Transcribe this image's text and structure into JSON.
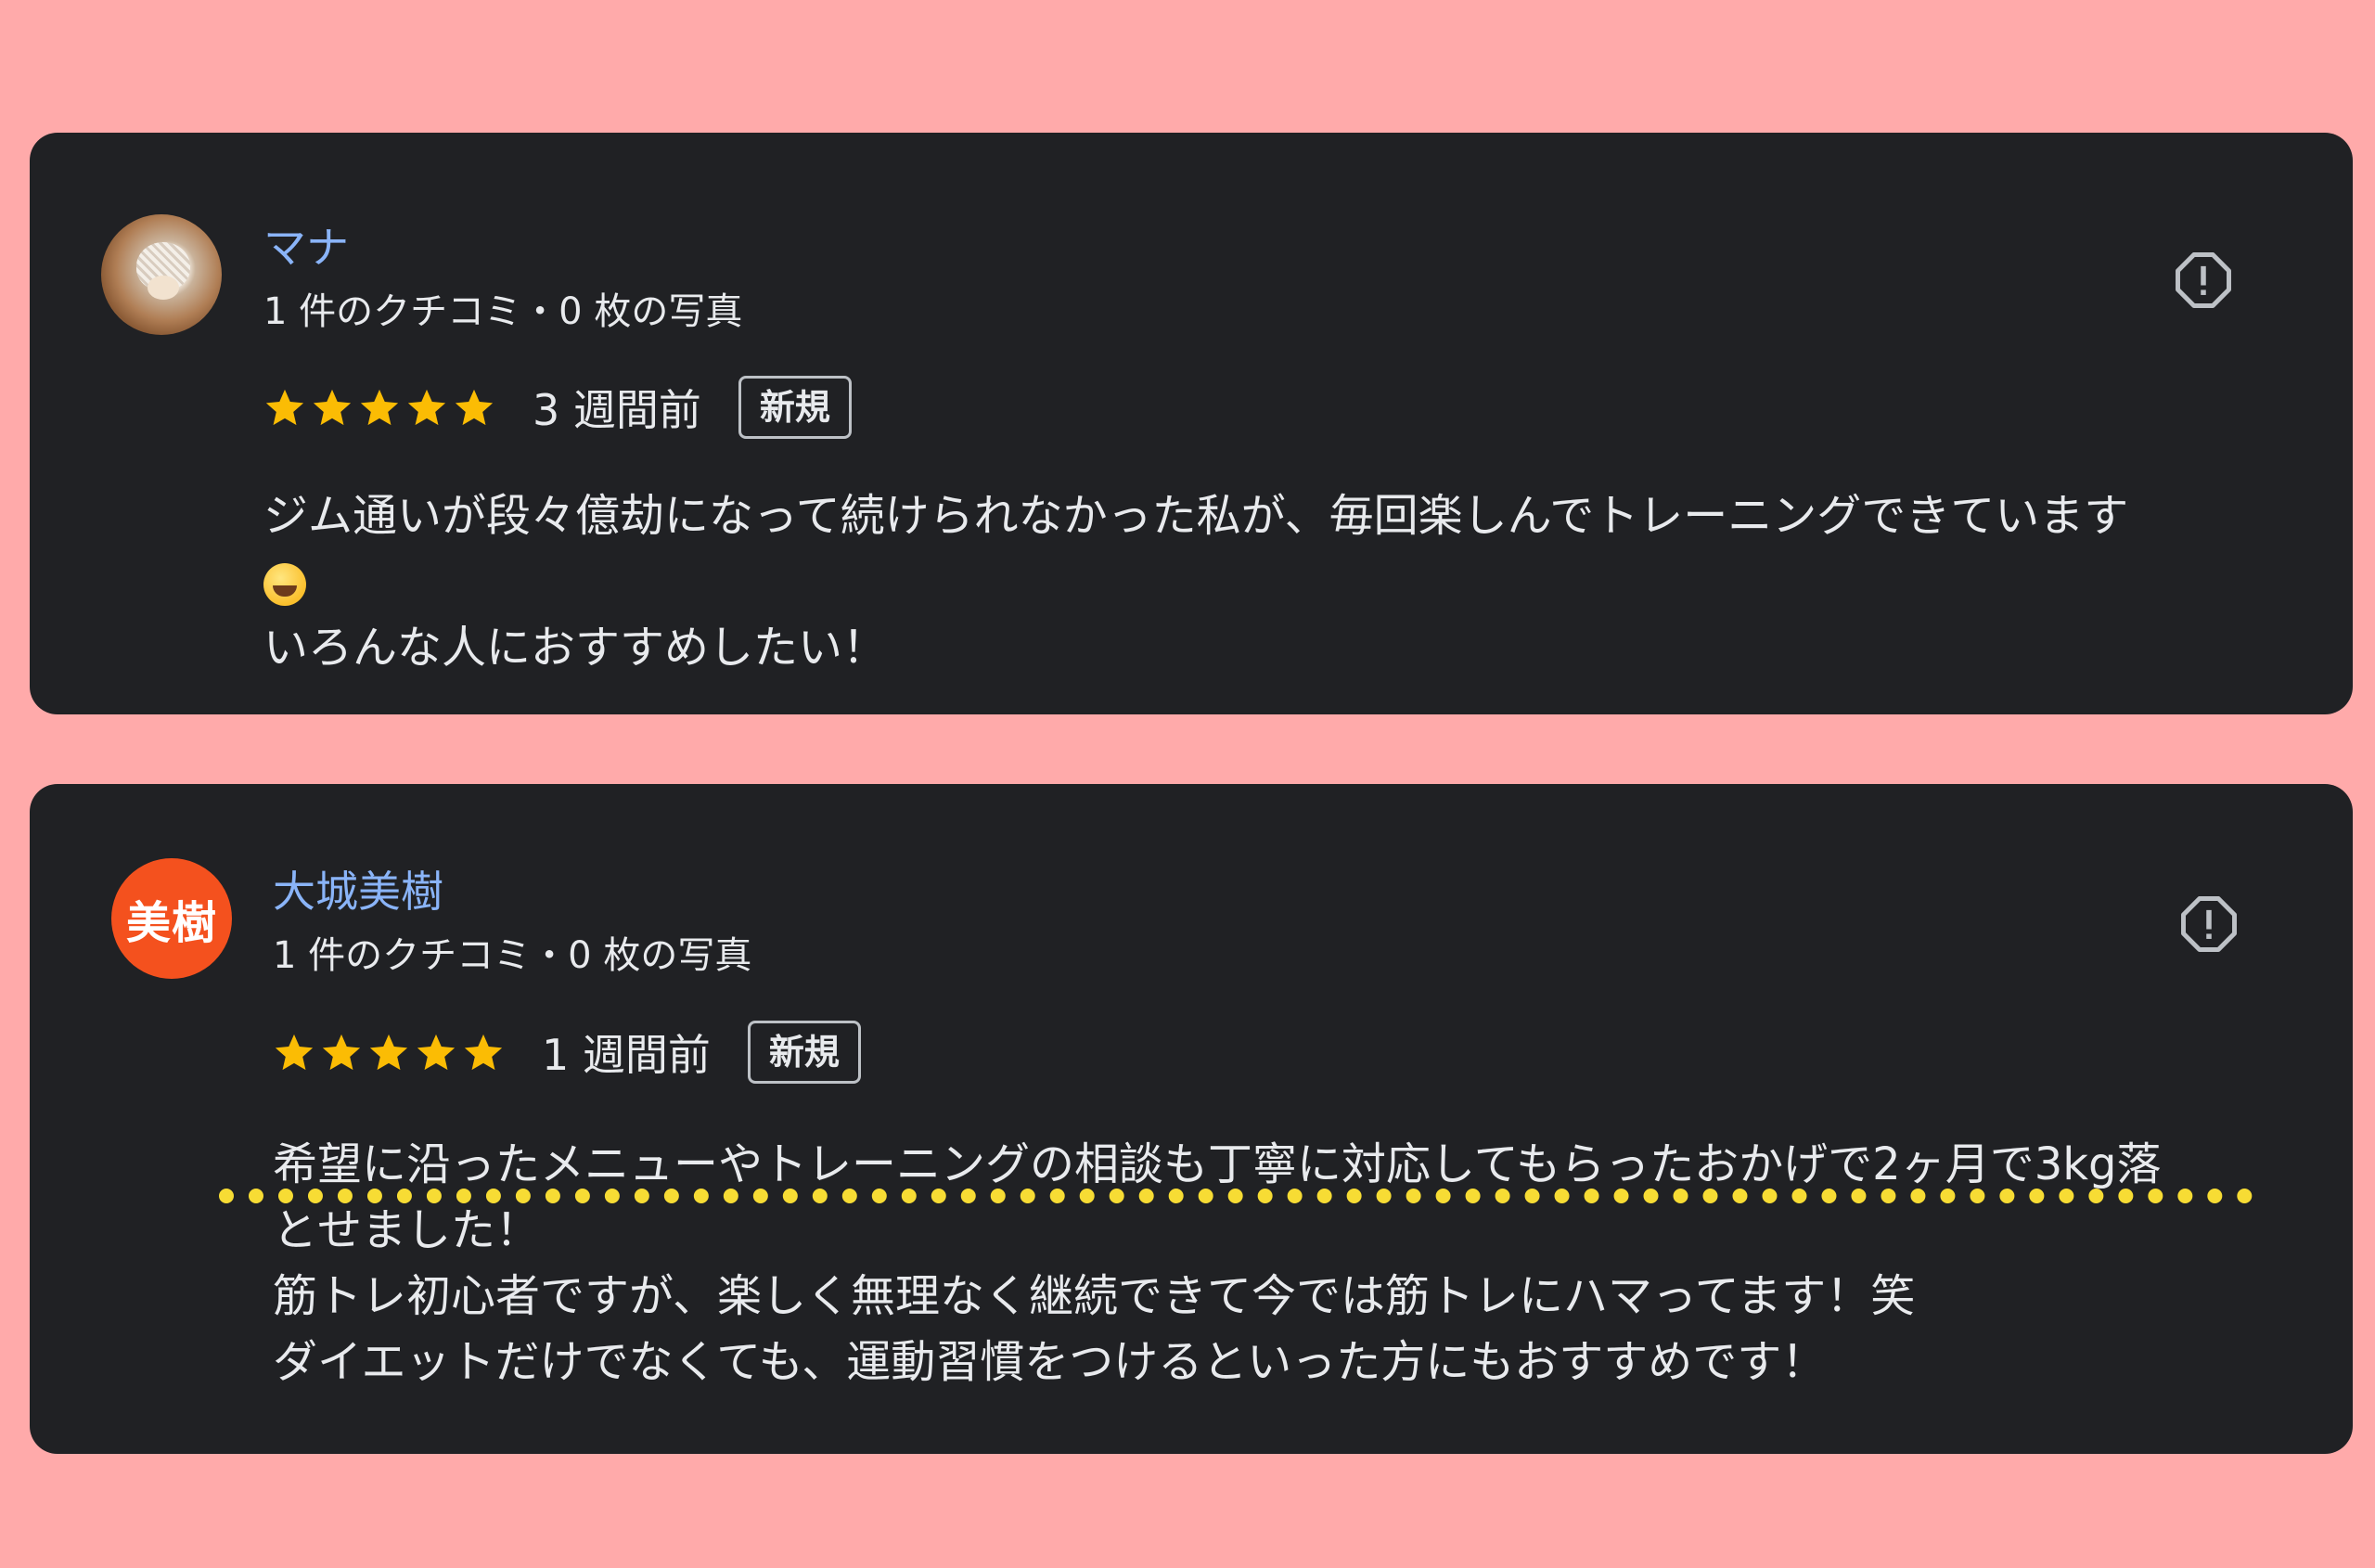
{
  "colors": {
    "background": "#ffaaaa",
    "card": "#202124",
    "name": "#8ab4f8",
    "text": "#e8eaed",
    "star": "#fbbc04",
    "avatar_letter_bg": "#f4511e",
    "dotted_line": "#f7dc34"
  },
  "reviews": [
    {
      "avatar_type": "photo",
      "avatar_icon": "hedgehog-photo",
      "name": "マナ",
      "meta": "1 件のクチコミ・0 枚の写真",
      "rating": 5,
      "time": "3 週間前",
      "badge": "新規",
      "report_icon": "report-icon",
      "text": {
        "line1": "ジム通いが段々億劫になって続けられなかった私が、毎回楽しんでトレーニングできています",
        "emoji": "grinning-squinting-face",
        "line3": "いろんな人におすすめしたい！"
      }
    },
    {
      "avatar_type": "letter",
      "avatar_text": "美樹",
      "name": "大城美樹",
      "meta": "1 件のクチコミ・0 枚の写真",
      "rating": 5,
      "time": "1 週間前",
      "badge": "新規",
      "report_icon": "report-icon",
      "text": {
        "line1": "希望に沿ったメニューやトレーニングの相談も丁寧に対応してもらったおかげで2ヶ月で3kg落",
        "line2": "とせました！",
        "line3": "筋トレ初心者ですが、楽しく無理なく継続できて今では筋トレにハマってます！笑",
        "line4": "ダイエットだけでなくても、運動習慣をつけるといった方にもおすすめです！"
      }
    }
  ]
}
